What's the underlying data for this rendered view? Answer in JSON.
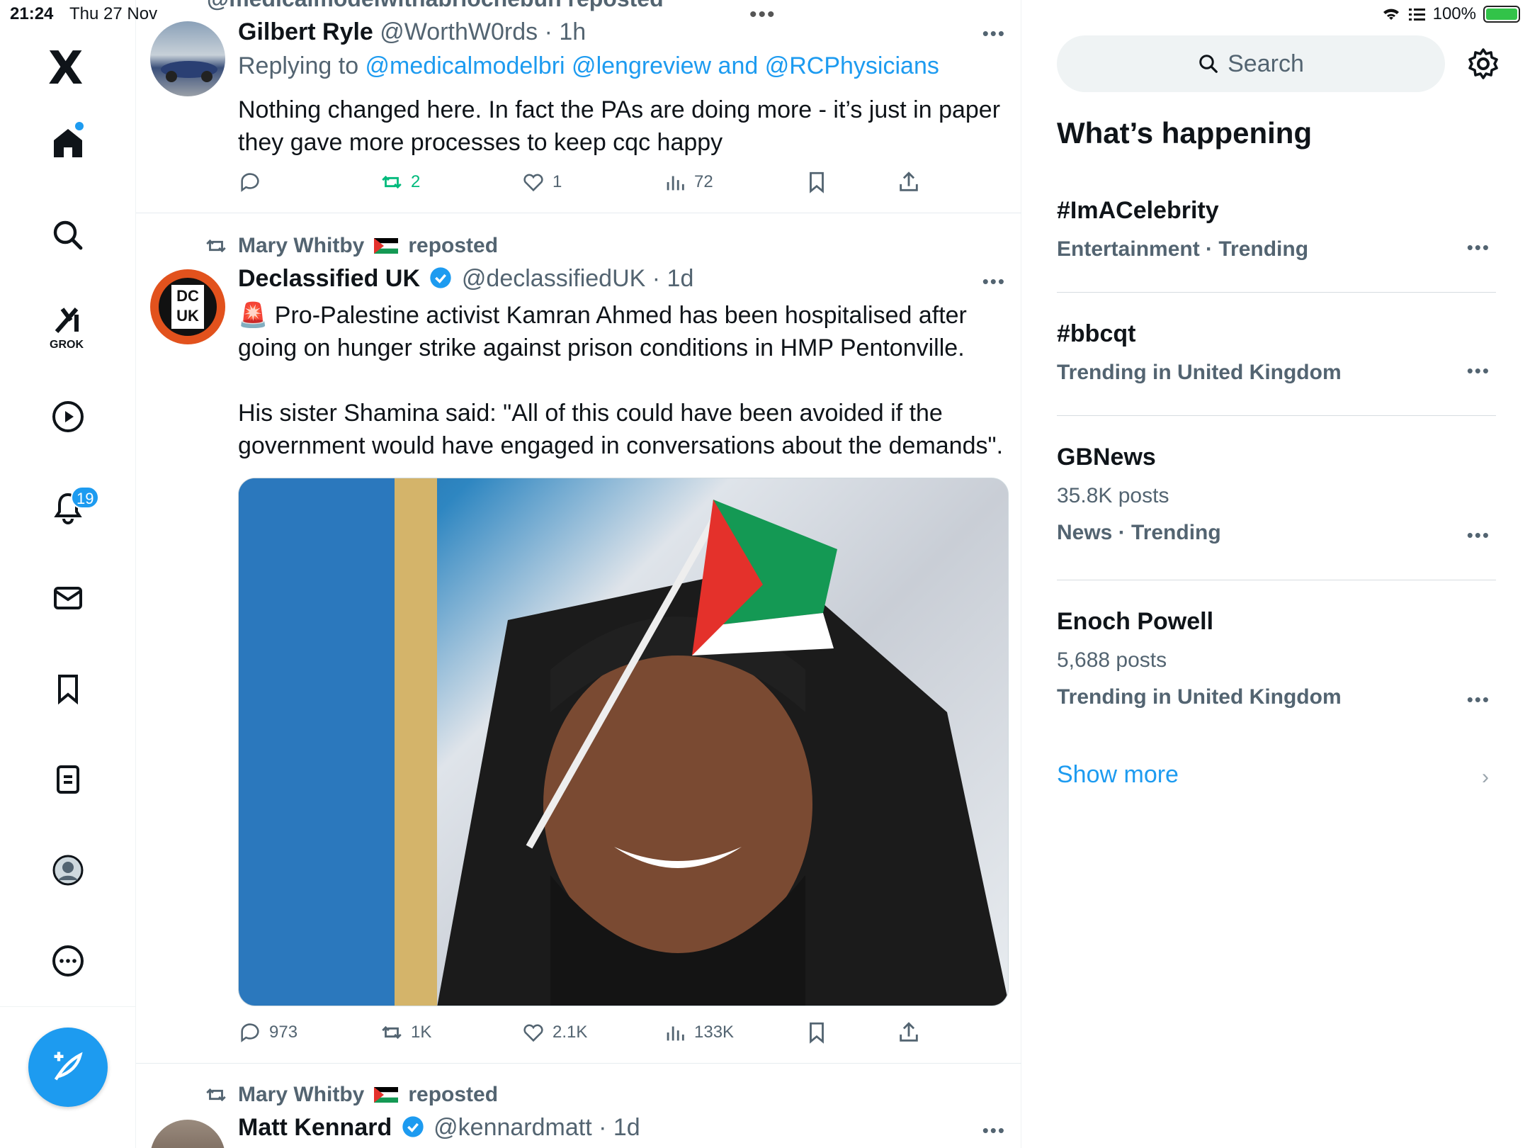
{
  "status_bar": {
    "time": "21:24",
    "date": "Thu 27 Nov",
    "battery": "100%",
    "dots": "•••"
  },
  "nav": {
    "logo": "X",
    "grok_label": "GROK",
    "notification_count": "19",
    "items": [
      "home-icon",
      "search-icon",
      "grok-icon",
      "video-icon",
      "bell-icon",
      "mail-icon",
      "bookmark-icon",
      "lists-icon",
      "profile-icon",
      "more-icon"
    ]
  },
  "feed": {
    "top_partial_text": "@medicalmodelwithabriochebun reposted",
    "tweets": [
      {
        "name": "Gilbert Ryle",
        "handle": "@WorthW0rds",
        "time": "· 1h",
        "reply_prefix": "Replying to ",
        "reply_to": "@medicalmodelbri @lengreview and @RCPhysicians",
        "text": "Nothing changed here. In fact the PAs are doing more - it’s just in paper\nthey gave more processes to keep cqc happy",
        "replies": "",
        "retweets": "2",
        "likes": "1",
        "views": "72",
        "more": "•••"
      },
      {
        "reposted_by": "Mary Whitby",
        "reposted_label": "reposted",
        "name": "Declassified UK",
        "handle": "@declassifiedUK",
        "time": "· 1d",
        "avatar_text": "DC UK",
        "text": "🚨 Pro-Palestine activist Kamran Ahmed has been hospitalised after\ngoing on hunger strike against prison conditions in HMP Pentonville.\n\nHis sister Shamina said: \"All of this could have been avoided if the\ngovernment would have engaged in conversations about the demands\".",
        "replies": "973",
        "retweets": "1K",
        "likes": "2.1K",
        "views": "133K",
        "more": "•••"
      },
      {
        "reposted_by": "Mary Whitby",
        "reposted_label": "reposted",
        "name": "Matt Kennard",
        "handle": "@kennardmatt",
        "time": "· 1d",
        "more": "•••"
      }
    ]
  },
  "right": {
    "search_placeholder": "Search",
    "section_title": "What’s happening",
    "trends": [
      {
        "title": "#ImACelebrity",
        "posts": "",
        "meta": "Entertainment · Trending"
      },
      {
        "title": "#bbcqt",
        "posts": "",
        "meta": "Trending in United Kingdom"
      },
      {
        "title": "GBNews",
        "posts": "35.8K posts",
        "meta": "News · Trending"
      },
      {
        "title": "Enoch Powell",
        "posts": "5,688 posts",
        "meta": "Trending in United Kingdom"
      }
    ],
    "show_more": "Show more",
    "trend_more": "•••"
  },
  "colors": {
    "accent": "#1d9bf0",
    "retweet_active": "#00ba7c",
    "secondary_text": "#536471"
  }
}
